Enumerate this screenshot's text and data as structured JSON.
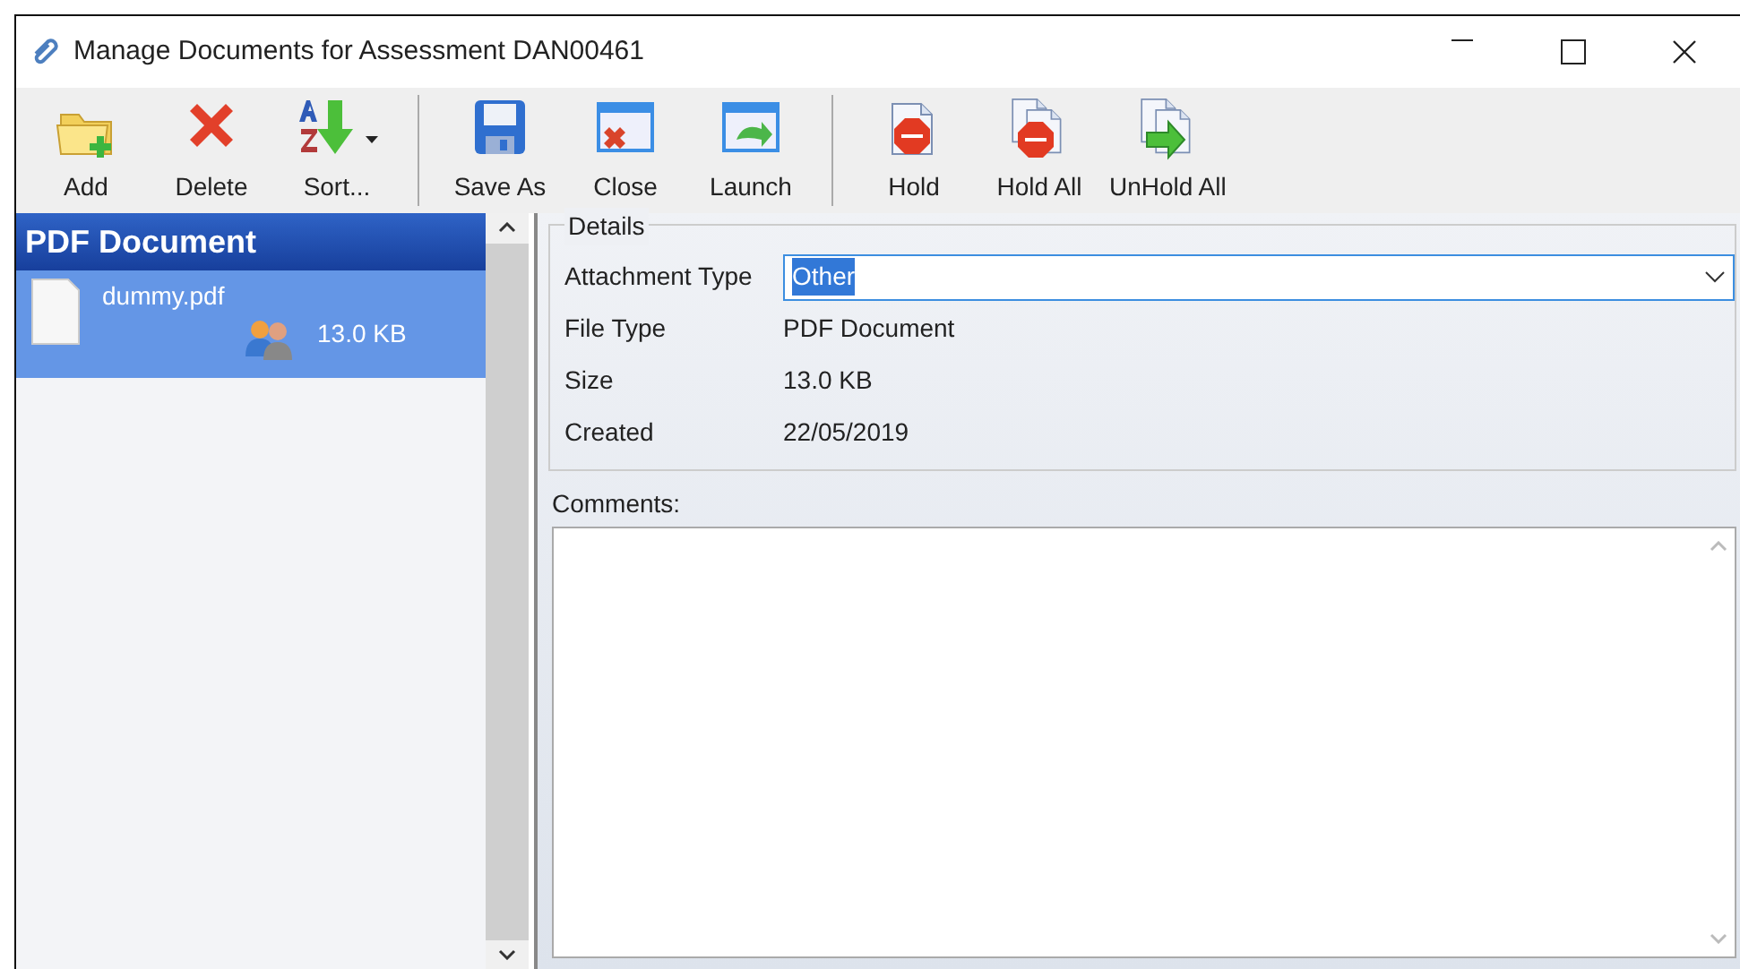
{
  "window": {
    "title": "Manage Documents for Assessment DAN00461"
  },
  "toolbar": [
    [
      {
        "label": "Add",
        "menu": false
      },
      {
        "label": "Delete",
        "menu": false
      },
      {
        "label": "Sort...",
        "menu": true
      }
    ],
    [
      {
        "label": "Save As",
        "menu": false
      },
      {
        "label": "Close",
        "menu": false
      },
      {
        "label": "Launch",
        "menu": false
      }
    ],
    [
      {
        "label": "Hold",
        "menu": false
      },
      {
        "label": "Hold All",
        "menu": false
      },
      {
        "label": "UnHold All",
        "menu": false
      }
    ]
  ],
  "document_list": {
    "group": "PDF Document",
    "items": [
      {
        "name": "dummy.pdf",
        "size": "13.0 KB",
        "selected": true
      }
    ]
  },
  "details": {
    "title": "Details",
    "attachment_type": {
      "label": "Attachment Type",
      "value": "Other",
      "focused": true
    },
    "fields": [
      {
        "label": "File Type",
        "value": "PDF Document"
      },
      {
        "label": "Size",
        "value": "13.0 KB"
      },
      {
        "label": "Created",
        "value": "22/05/2019"
      }
    ]
  },
  "comments": {
    "label": "Comments:"
  }
}
